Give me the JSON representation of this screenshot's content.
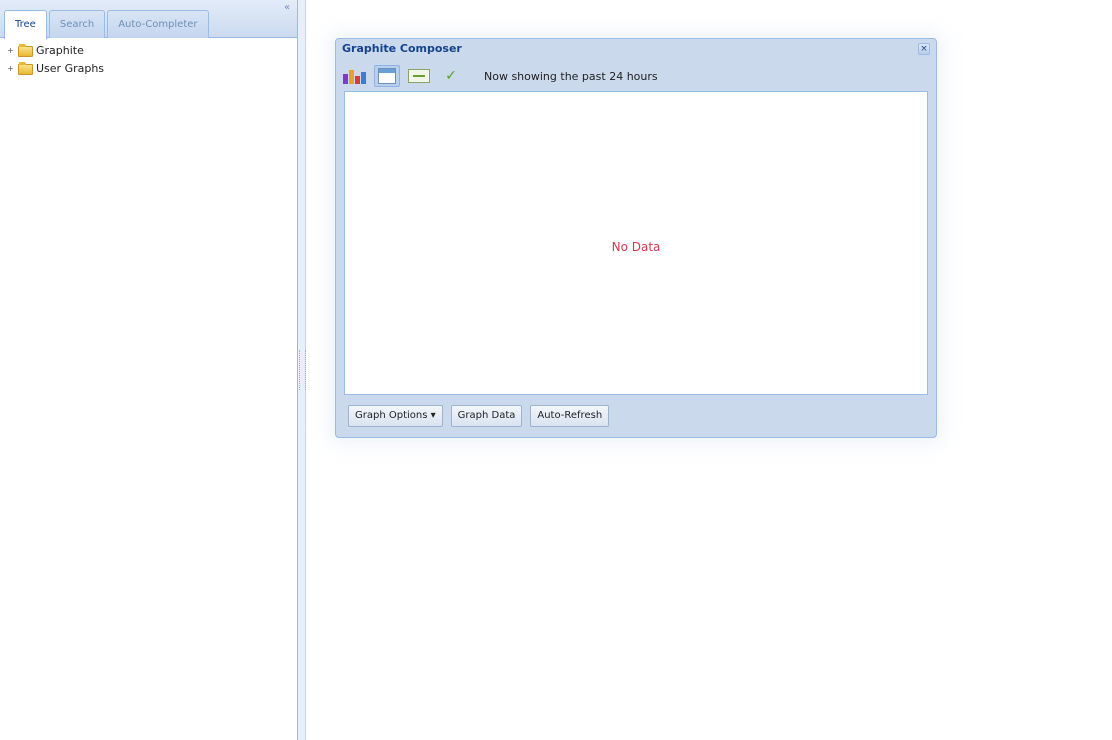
{
  "left_panel": {
    "tabs": [
      {
        "label": "Tree",
        "active": true
      },
      {
        "label": "Search",
        "active": false
      },
      {
        "label": "Auto-Completer",
        "active": false
      }
    ],
    "tree": [
      {
        "label": "Graphite",
        "icon": "folder-icon",
        "expander": "+"
      },
      {
        "label": "User Graphs",
        "icon": "folder-icon",
        "expander": "+"
      }
    ]
  },
  "composer": {
    "title": "Graphite Composer",
    "toolbar_text": "Now showing the past 24 hours",
    "body_message": "No Data",
    "footer_buttons": [
      {
        "label": "Graph Options ▾"
      },
      {
        "label": "Graph Data"
      },
      {
        "label": "Auto-Refresh"
      }
    ]
  },
  "colors": {
    "panel_border": "#99bbe8",
    "window_bg": "#cad9ec",
    "header_text": "#15428b",
    "no_data_text": "#d23a52"
  }
}
